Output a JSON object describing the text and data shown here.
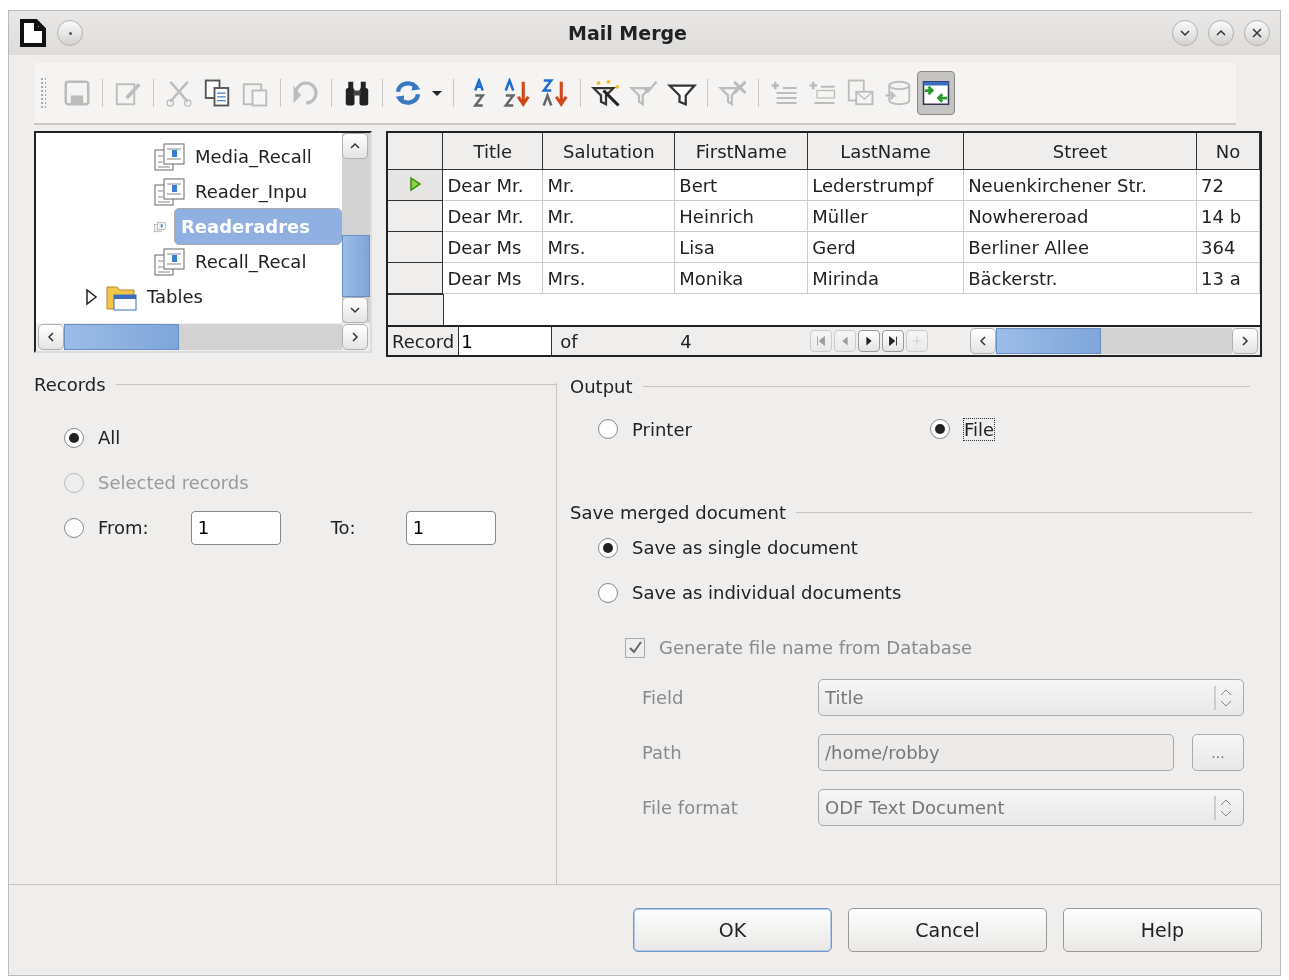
{
  "window": {
    "title": "Mail Merge"
  },
  "toolbar": {
    "groups": [
      [
        {
          "disabled": true,
          "pressed": false
        }
      ],
      [
        {
          "disabled": true,
          "pressed": false
        }
      ],
      [
        {
          "disabled": true,
          "pressed": false
        },
        {
          "disabled": false,
          "pressed": false
        },
        {
          "disabled": true,
          "pressed": false
        }
      ],
      [
        {
          "disabled": true,
          "pressed": false
        }
      ],
      [
        {
          "disabled": false,
          "pressed": false
        }
      ],
      [
        {
          "disabled": false,
          "pressed": false
        },
        {
          "disabled": false,
          "pressed": false
        }
      ],
      [
        {
          "disabled": false,
          "pressed": false
        },
        {
          "disabled": false,
          "pressed": false
        },
        {
          "disabled": false,
          "pressed": false
        }
      ],
      [
        {
          "disabled": false,
          "pressed": false
        },
        {
          "disabled": true,
          "pressed": false
        },
        {
          "disabled": false,
          "pressed": false
        }
      ],
      [
        {
          "disabled": true,
          "pressed": false
        }
      ],
      [
        {
          "disabled": true,
          "pressed": false
        },
        {
          "disabled": true,
          "pressed": false
        },
        {
          "disabled": true,
          "pressed": false
        },
        {
          "disabled": true,
          "pressed": false
        },
        {
          "disabled": false,
          "pressed": true
        }
      ]
    ]
  },
  "tree": {
    "items": [
      {
        "kind": "query",
        "label": "Media_Recall",
        "selected": false
      },
      {
        "kind": "query",
        "label": "Reader_Inpu",
        "selected": false
      },
      {
        "kind": "query",
        "label": "Readeradres",
        "selected": true
      },
      {
        "kind": "query",
        "label": "Recall_Recal",
        "selected": false
      },
      {
        "kind": "folder",
        "label": "Tables",
        "expanded": false,
        "selected": false
      }
    ]
  },
  "table": {
    "columns": [
      "Title",
      "Salutation",
      "FirstName",
      "LastName",
      "Street",
      "No"
    ],
    "rows": [
      {
        "current": true,
        "cells": [
          "Dear Mr.",
          "Mr.",
          "Bert",
          "Lederstrumpf",
          "Neuenkirchener Str.",
          "72"
        ]
      },
      {
        "current": false,
        "cells": [
          "Dear Mr.",
          "Mr.",
          "Heinrich",
          "Müller",
          "Nowhereroad",
          "14 b"
        ]
      },
      {
        "current": false,
        "cells": [
          "Dear Ms",
          "Mrs.",
          "Lisa",
          "Gerd",
          "Berliner Allee",
          "364"
        ]
      },
      {
        "current": false,
        "cells": [
          "Dear Ms",
          "Mrs.",
          "Monika",
          "Mirinda",
          "Bäckerstr.",
          "13 a"
        ]
      }
    ],
    "navigation": {
      "record_label": "Record",
      "record_value": "1",
      "of_label": "of",
      "total": "4",
      "buttons": [
        {
          "disabled": true
        },
        {
          "disabled": true
        },
        {
          "disabled": false
        },
        {
          "disabled": false
        },
        {
          "disabled": true
        }
      ]
    }
  },
  "records": {
    "title": "Records",
    "options": [
      {
        "label": "All",
        "selected": true,
        "disabled": false
      },
      {
        "label": "Selected records",
        "selected": false,
        "disabled": true
      },
      {
        "label": "From:",
        "selected": false,
        "disabled": false
      }
    ],
    "from_value": "1",
    "to_label": "To:",
    "to_value": "1"
  },
  "output": {
    "title": "Output",
    "options": [
      {
        "label": "Printer",
        "selected": false,
        "focused": false
      },
      {
        "label": "File",
        "selected": true,
        "focused": true
      }
    ],
    "save": {
      "title": "Save merged document",
      "options": [
        {
          "label": "Save as single document",
          "selected": true
        },
        {
          "label": "Save as individual documents",
          "selected": false
        }
      ],
      "generate": {
        "label": "Generate file name from Database",
        "checked": true,
        "disabled": true
      },
      "fields": [
        {
          "kind": "select",
          "label": "Field",
          "value": "Title",
          "disabled": true
        },
        {
          "kind": "path",
          "label": "Path",
          "value": "/home/robby",
          "button": "...",
          "disabled": true
        },
        {
          "kind": "select",
          "label": "File format",
          "value": "ODF Text Document",
          "disabled": true
        }
      ]
    }
  },
  "buttons": [
    {
      "label": "OK",
      "default": true
    },
    {
      "label": "Cancel",
      "default": false
    },
    {
      "label": "Help",
      "default": false
    }
  ]
}
